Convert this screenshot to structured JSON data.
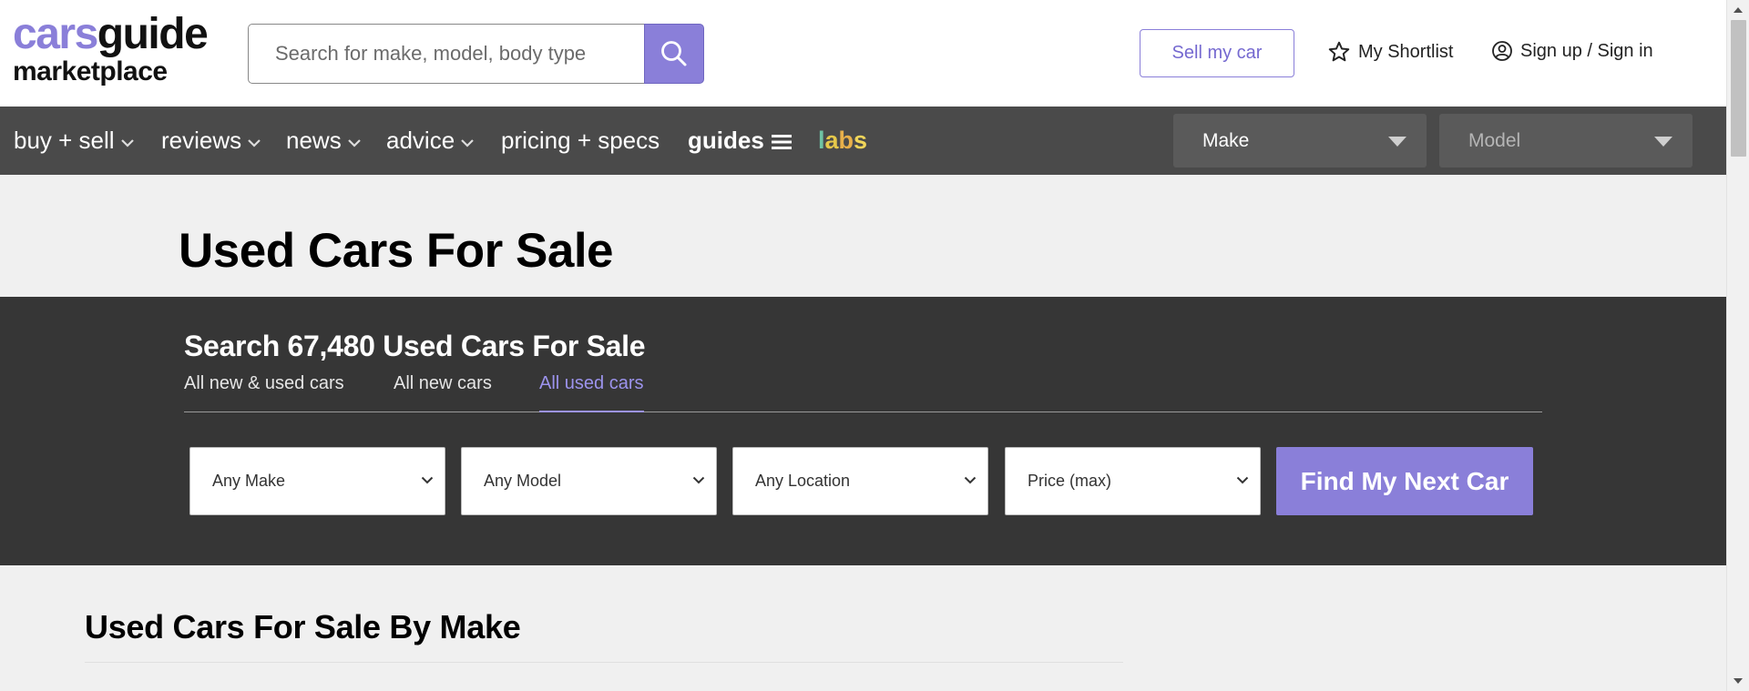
{
  "header": {
    "logo_line1_a": "cars",
    "logo_line1_b": "guide",
    "logo_line2": "marketplace",
    "search_placeholder": "Search for make, model, body type",
    "sell_label": "Sell my car",
    "shortlist_label": "My Shortlist",
    "signin_label": "Sign up / Sign in"
  },
  "nav": {
    "items": [
      {
        "label": "buy + sell"
      },
      {
        "label": "reviews"
      },
      {
        "label": "news"
      },
      {
        "label": "advice"
      },
      {
        "label": "pricing + specs"
      },
      {
        "label": "guides"
      }
    ],
    "labs": [
      "l",
      "a",
      "b",
      "s"
    ],
    "make_select": "Make",
    "model_select": "Model"
  },
  "hero": {
    "title": "Used Cars For Sale"
  },
  "search_panel": {
    "title": "Search 67,480 Used Cars For Sale",
    "tabs": [
      {
        "label": "All new & used cars"
      },
      {
        "label": "All new cars"
      },
      {
        "label": "All used cars"
      }
    ],
    "selects": [
      {
        "label": "Any Make"
      },
      {
        "label": "Any Model"
      },
      {
        "label": "Any Location"
      },
      {
        "label": "Price (max)"
      }
    ],
    "find_label": "Find My Next Car"
  },
  "by_make": {
    "title": "Used Cars For Sale By Make"
  },
  "colors": {
    "accent": "#8a7fd9",
    "nav_bg": "#4a4a4a",
    "panel_bg": "#363636",
    "page_bg": "#f0f0f0"
  }
}
